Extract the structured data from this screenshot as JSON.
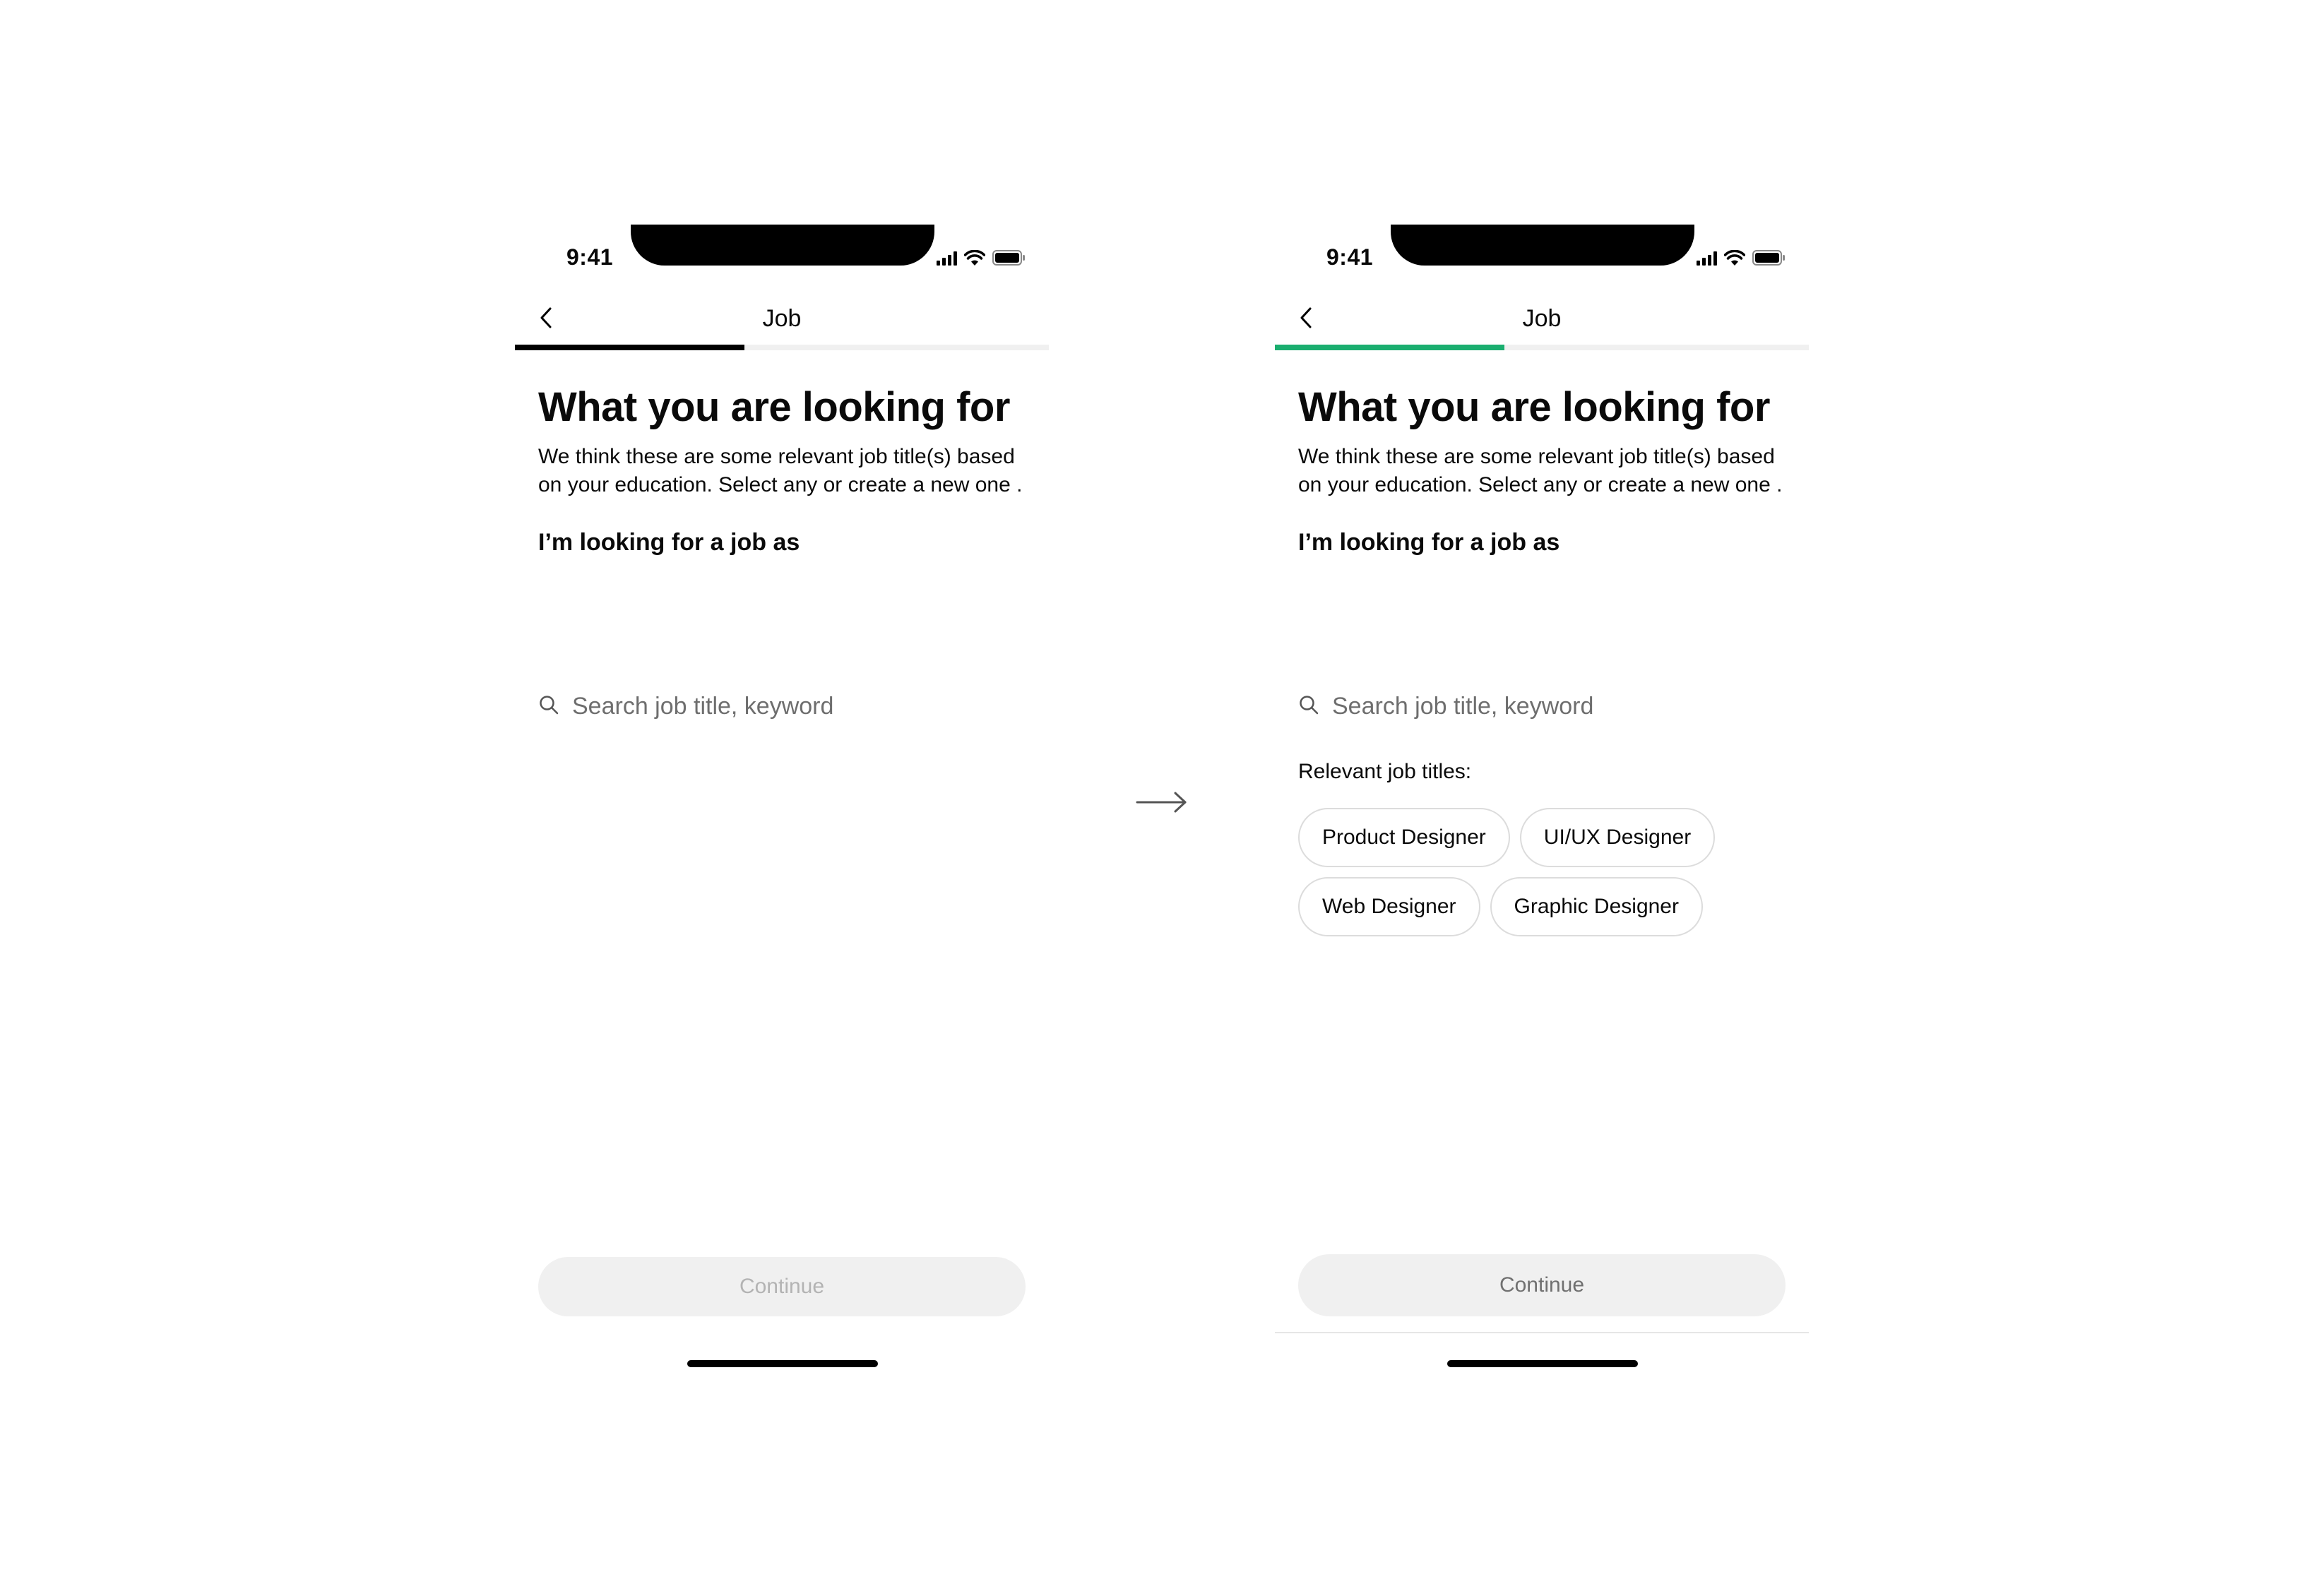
{
  "screens": [
    {
      "id": "before",
      "status_time": "9:41",
      "nav_title": "Job",
      "progress": {
        "fraction": 0.43,
        "color": "#000000"
      },
      "heading": "What you are looking for",
      "subtext": "We think these are some relevant job title(s) based on your education. Select any or create a new one .",
      "section_label": "I’m looking for a job as",
      "search_placeholder": "Search job title, keyword",
      "continue_label": "Continue",
      "continue_state": "disabled"
    },
    {
      "id": "after",
      "status_time": "9:41",
      "nav_title": "Job",
      "progress": {
        "fraction": 0.43,
        "color": "#1aae6f"
      },
      "heading": "What you are looking for",
      "subtext": "We think these are some relevant job title(s) based on your education. Select any or create a new one .",
      "section_label": "I’m looking for a job as",
      "search_placeholder": "Search job title, keyword",
      "relevant_label": "Relevant job titles:",
      "job_chips": [
        "Product Designer",
        "UI/UX Designer",
        "Web Designer",
        "Graphic Designer"
      ],
      "continue_label": "Continue",
      "continue_state": "enabled"
    }
  ],
  "icons": {
    "back": "chevron-left-icon",
    "search": "search-icon",
    "signal": "cellular-signal-icon",
    "wifi": "wifi-icon",
    "battery": "battery-icon",
    "transition": "arrow-right-icon"
  }
}
